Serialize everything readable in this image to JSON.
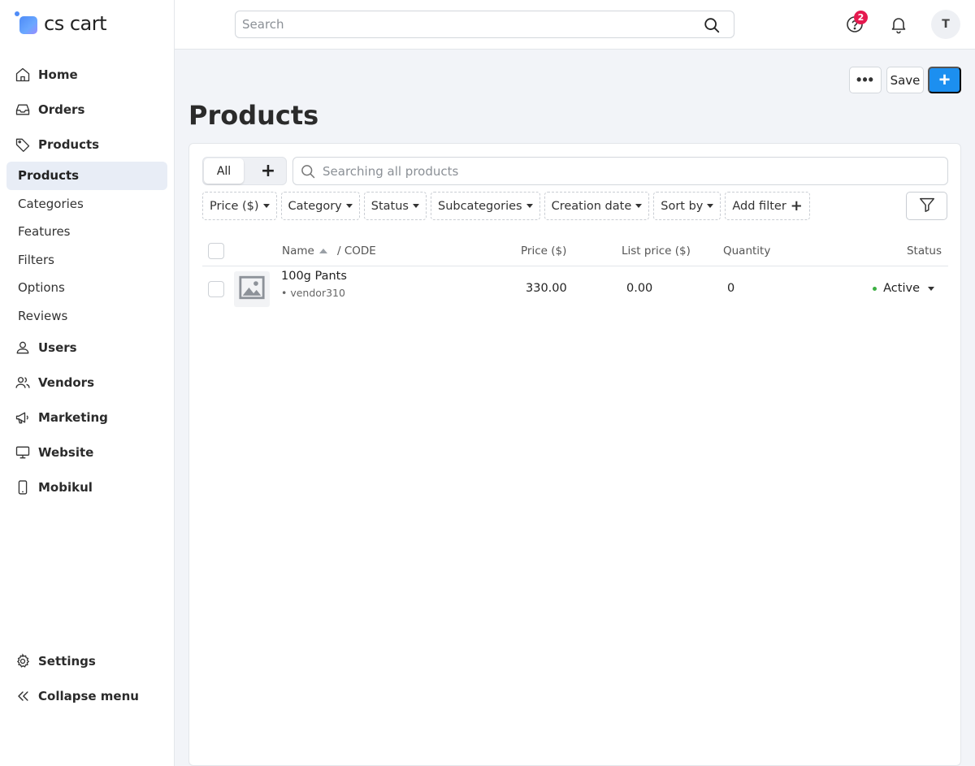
{
  "brand": {
    "logo_text": "cs cart"
  },
  "sidebar": {
    "items": [
      {
        "label": "Home",
        "icon": "home-icon"
      },
      {
        "label": "Orders",
        "icon": "inbox-icon"
      },
      {
        "label": "Products",
        "icon": "tag-icon"
      }
    ],
    "products_sub": [
      {
        "label": "Products",
        "active": true
      },
      {
        "label": "Categories"
      },
      {
        "label": "Features"
      },
      {
        "label": "Filters"
      },
      {
        "label": "Options"
      },
      {
        "label": "Reviews"
      }
    ],
    "items_after": [
      {
        "label": "Users",
        "icon": "user-icon"
      },
      {
        "label": "Vendors",
        "icon": "users-icon"
      },
      {
        "label": "Marketing",
        "icon": "megaphone-icon"
      },
      {
        "label": "Website",
        "icon": "monitor-icon"
      },
      {
        "label": "Mobikul",
        "icon": "smartphone-icon"
      }
    ],
    "bottom": [
      {
        "label": "Settings",
        "icon": "gear-icon"
      },
      {
        "label": "Collapse menu",
        "icon": "chevrons-left-icon"
      }
    ]
  },
  "topbar": {
    "search_placeholder": "Search",
    "help_badge": "2",
    "avatar_initial": "T"
  },
  "toolbar": {
    "more_label": "•••",
    "save_label": "Save",
    "add_label": "+"
  },
  "page": {
    "title": "Products"
  },
  "tabs": {
    "all_label": "All",
    "add_label": "+"
  },
  "product_search": {
    "placeholder": "Searching all products"
  },
  "filters": [
    {
      "label": "Price ($)"
    },
    {
      "label": "Category"
    },
    {
      "label": "Status"
    },
    {
      "label": "Subcategories"
    },
    {
      "label": "Creation date"
    },
    {
      "label": "Sort by"
    }
  ],
  "add_filter_label": "Add filter",
  "table": {
    "headers": {
      "name": "Name",
      "code": "/  CODE",
      "price": "Price ($)",
      "list_price": "List price ($)",
      "quantity": "Quantity",
      "status": "Status"
    },
    "rows": [
      {
        "name": "100g Pants",
        "code": "• vendor310",
        "price": "330.00",
        "list_price": "0.00",
        "quantity": "0",
        "status": "Active"
      }
    ]
  },
  "colors": {
    "accent": "#1c8ff0",
    "badge": "#e5194f",
    "status_active": "#3cb043",
    "active_nav_bg": "#e8edf6"
  }
}
